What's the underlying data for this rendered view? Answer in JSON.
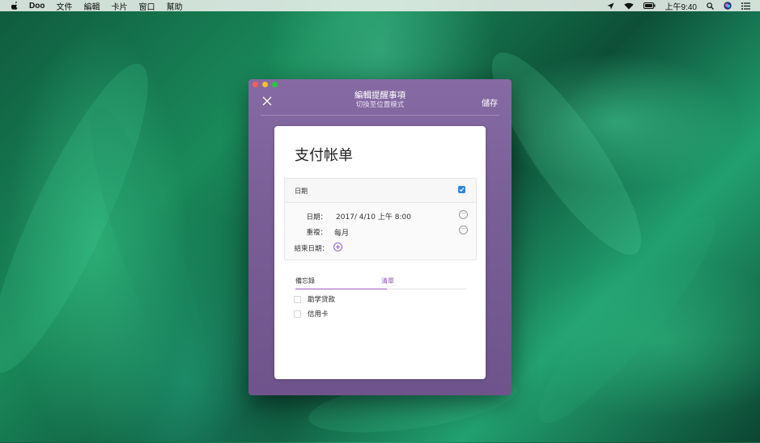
{
  "menubar": {
    "app_name": "Doo",
    "menus": [
      "文件",
      "編輯",
      "卡片",
      "窗口",
      "幫助"
    ],
    "clock": "上午9:40"
  },
  "window": {
    "title": "編輯提醒事項",
    "subtitle": "切換至位置模式",
    "save_label": "儲存"
  },
  "task": {
    "title": "支付帐单",
    "date_section": {
      "header_label": "日期",
      "enabled": true,
      "date_label": "日期：",
      "date_value": "2017/ 4/10  上午  8:00",
      "repeat_label": "重複：",
      "repeat_value": "每月",
      "end_date_label": "結束日期："
    },
    "tabs": {
      "notes_label": "備忘錄",
      "list_label": "清單"
    },
    "checklist": [
      {
        "label": "助学贷款",
        "checked": false
      },
      {
        "label": "信用卡",
        "checked": false
      }
    ]
  },
  "colors": {
    "window_purple": "#7a5f97",
    "accent_purple": "#9b59c9",
    "checkbox_blue": "#2d82e5"
  }
}
